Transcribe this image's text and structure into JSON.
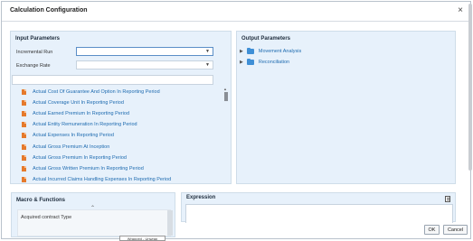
{
  "dialog": {
    "title": "Calculation Configuration",
    "close_glyph": "×"
  },
  "input_parameters": {
    "title": "Input Parameters",
    "incremental_run_label": "Incremental Run",
    "incremental_run_value": "",
    "exchange_rate_label": "Exchange Rate",
    "exchange_rate_value": "",
    "items": [
      "Actual Cost Of Guarantee And Option In Reporting Period",
      "Actual Coverage Unit In Reporting Period",
      "Actual Earned Premium In Reporting Period",
      "Actual Entity Remuneration In Reporting Period",
      "Actual Expenses In Reporting Period",
      "Actual Gross Premium At Inception",
      "Actual Gross Premium In Reporting Period",
      "Actual Gross Written Premium In Reporting Period",
      "Actual Incurred Claims Handling Expenses In Reporting Period"
    ]
  },
  "output_parameters": {
    "title": "Output Parameters",
    "tree": [
      "Movement Analysis",
      "Reconciliation"
    ]
  },
  "macro": {
    "title": "Macro & Functions",
    "items": [
      "Acquired contract Type"
    ]
  },
  "expression": {
    "title": "Expression",
    "value": ""
  },
  "buttons": {
    "ok": "OK",
    "cancel": "Cancel"
  },
  "tooltip": "Wrapped - Unwrap",
  "icons": {
    "list_item": "document-icon",
    "tree_item": "folder-icon",
    "dropdown": "chevron-down-icon",
    "expand": "chevron-right-icon",
    "scroll_up": "chevron-up-icon",
    "edit": "edit-icon"
  },
  "colors": {
    "panel_bg": "#e7f1fb",
    "link": "#1e6bb0",
    "doc_icon": "#e57a2c",
    "folder_icon": "#3f8fd6"
  }
}
